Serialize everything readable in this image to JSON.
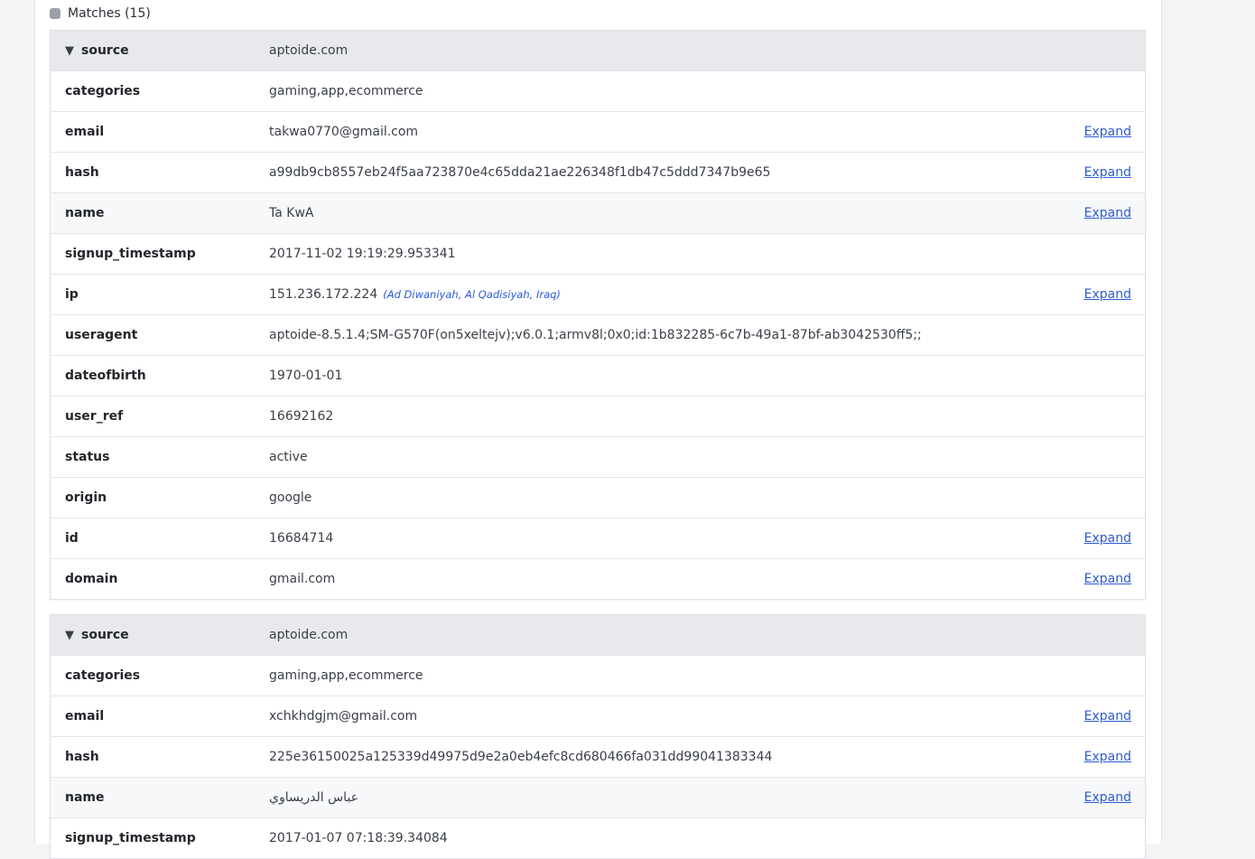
{
  "matches_label": "Matches (15)",
  "expand_label": "Expand",
  "records": [
    {
      "source": {
        "key": "source",
        "value": "aptoide.com"
      },
      "fields": [
        {
          "key": "categories",
          "value": "gaming,app,ecommerce",
          "expand": false
        },
        {
          "key": "email",
          "value": "takwa0770@gmail.com",
          "expand": true
        },
        {
          "key": "hash",
          "value": "a99db9cb8557eb24f5aa723870e4c65dda21ae226348f1db47c5ddd7347b9e65",
          "expand": true
        },
        {
          "key": "name",
          "value": "Ta KwA",
          "expand": true
        },
        {
          "key": "signup_timestamp",
          "value": "2017-11-02 19:19:29.953341",
          "expand": false
        },
        {
          "key": "ip",
          "value": "151.236.172.224",
          "geo": "(Ad Diwaniyah, Al Qadisiyah, Iraq)",
          "expand": true
        },
        {
          "key": "useragent",
          "value": "aptoide-8.5.1.4;SM-G570F(on5xeltejv);v6.0.1;armv8l;0x0;id:1b832285-6c7b-49a1-87bf-ab3042530ff5;;",
          "expand": false
        },
        {
          "key": "dateofbirth",
          "value": "1970-01-01",
          "expand": false
        },
        {
          "key": "user_ref",
          "value": "16692162",
          "expand": false
        },
        {
          "key": "status",
          "value": "active",
          "expand": false
        },
        {
          "key": "origin",
          "value": "google",
          "expand": false
        },
        {
          "key": "id",
          "value": "16684714",
          "expand": true
        },
        {
          "key": "domain",
          "value": "gmail.com",
          "expand": true
        }
      ]
    },
    {
      "source": {
        "key": "source",
        "value": "aptoide.com"
      },
      "fields": [
        {
          "key": "categories",
          "value": "gaming,app,ecommerce",
          "expand": false
        },
        {
          "key": "email",
          "value": "xchkhdgjm@gmail.com",
          "expand": true
        },
        {
          "key": "hash",
          "value": "225e36150025a125339d49975d9e2a0eb4efc8cd680466fa031dd99041383344",
          "expand": true
        },
        {
          "key": "name",
          "value": "عباس الدريساوي",
          "expand": true
        },
        {
          "key": "signup_timestamp",
          "value": "2017-01-07 07:18:39.34084",
          "expand": false
        }
      ]
    }
  ]
}
